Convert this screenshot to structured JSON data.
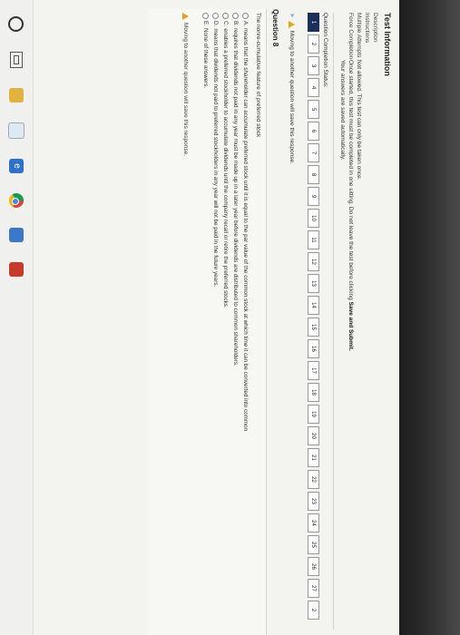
{
  "test_information": {
    "title": "Test Information",
    "rows": [
      {
        "key": "Description",
        "value": ""
      },
      {
        "key": "Instructions",
        "value": ""
      },
      {
        "key": "Multiple Attempts",
        "value": "Not allowed. This test can only be taken once."
      },
      {
        "key": "Force Completion",
        "value": "Once started, this test must be completed in one sitting. Do not leave the test before clicking ",
        "value_bold": "Save and Submit."
      },
      {
        "key": "",
        "value": "Your answers are saved automatically."
      }
    ]
  },
  "completion_status": {
    "label": "Question Completion Status:",
    "questions": [
      "1",
      "2",
      "3",
      "4",
      "5",
      "6",
      "7",
      "8",
      "9",
      "10",
      "11",
      "12",
      "13",
      "14",
      "15",
      "16",
      "17",
      "18",
      "19",
      "20",
      "21",
      "22",
      "23",
      "24",
      "25",
      "26",
      "27",
      "2"
    ],
    "current_index": 0
  },
  "notice_top": "Moving to another question will save this response.",
  "question": {
    "header": "Question 8",
    "text": "The nonre-cumulative feature of preferred stock",
    "choices": [
      {
        "letter": "A.",
        "text": "means that the shareholder can accumulate preferred stock until it is equal to the par value of the common stock at which time it can be converted into common"
      },
      {
        "letter": "B.",
        "text": "requires that dividends not paid in any year must be made up in a later year before dividends are distributed to common shareholders."
      },
      {
        "letter": "C.",
        "text": "enables a preferred stockholder to accumulate dividends until the company recall or retire the preferred stocks."
      },
      {
        "letter": "D.",
        "text": "means that dividends not paid to preferred stockholders in any year will not be paid in the future years."
      },
      {
        "letter": "E.",
        "text": "None of these answers."
      }
    ]
  },
  "notice_bottom": "Moving to another question will save this response.",
  "taskbar": {
    "icons": [
      "cortana-icon",
      "task-view-icon",
      "file-explorer-icon",
      "store-icon",
      "edge-icon",
      "chrome-icon",
      "mail-icon",
      "pdf-icon"
    ],
    "edge_glyph": "e"
  },
  "colors": {
    "current_question": "#1c2f5a",
    "warning": "#e8a21a"
  }
}
